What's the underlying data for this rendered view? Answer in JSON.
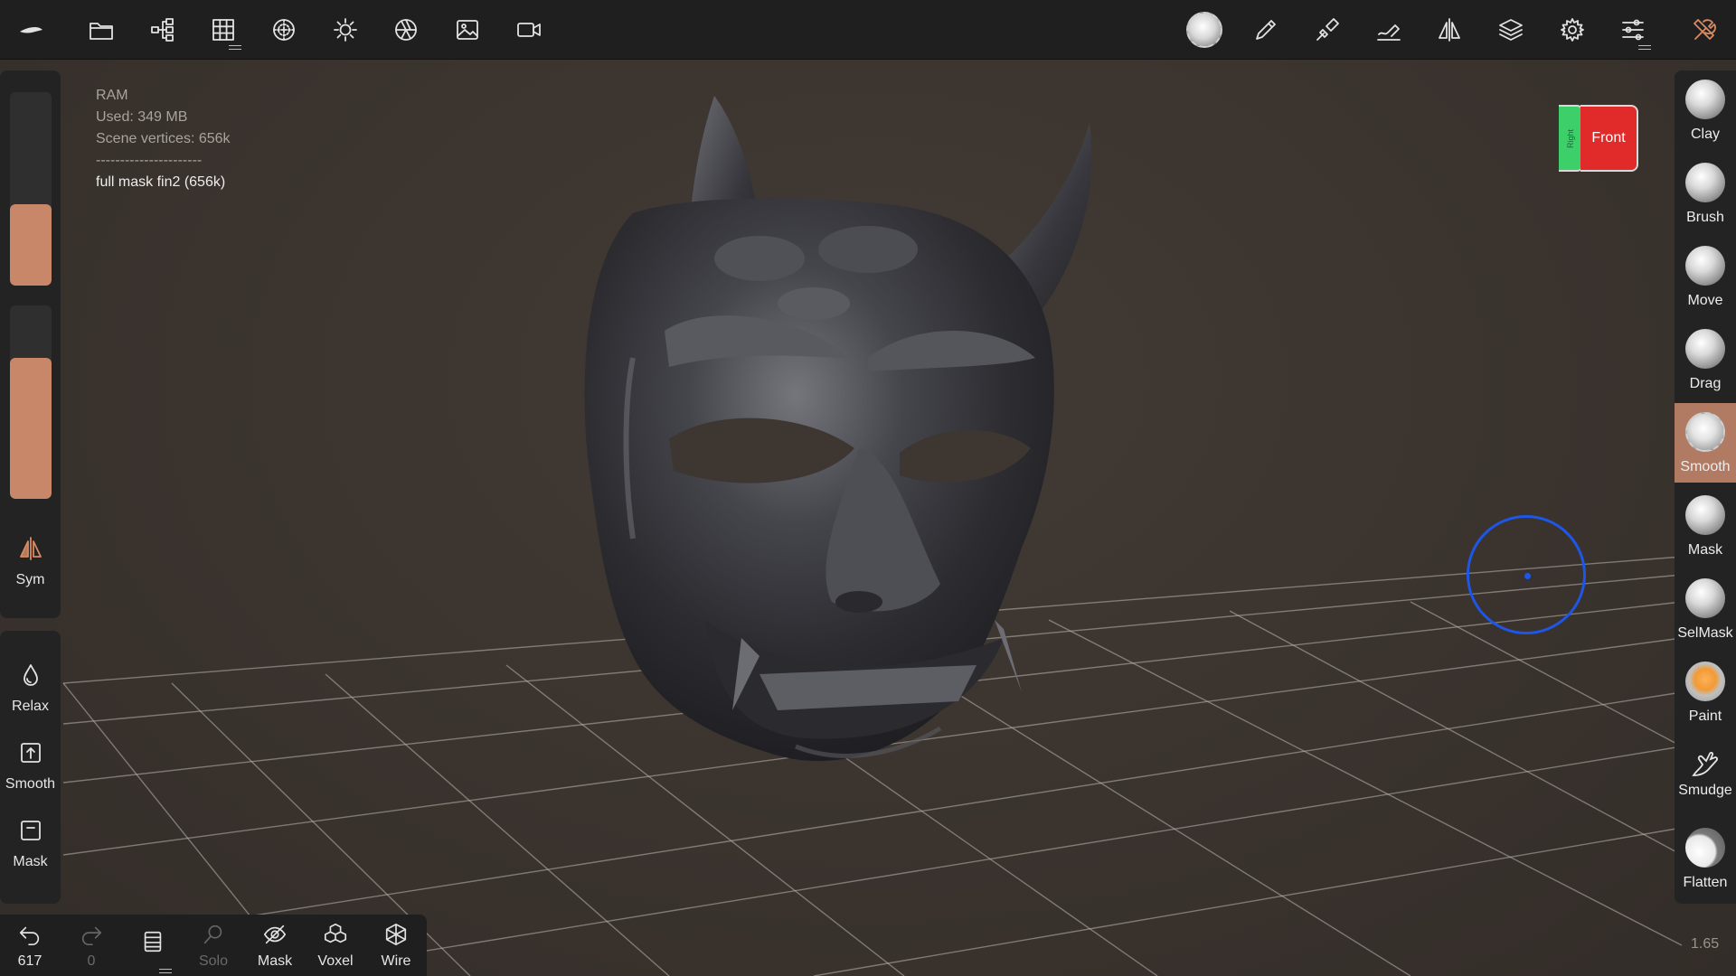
{
  "toolbar": {
    "left_icons": [
      {
        "name": "app-logo-icon"
      },
      {
        "name": "folder-icon"
      },
      {
        "name": "scene-tree-icon"
      },
      {
        "name": "topology-grid-icon"
      },
      {
        "name": "material-sphere-icon"
      },
      {
        "name": "lighting-sun-icon"
      },
      {
        "name": "camera-aperture-icon"
      },
      {
        "name": "background-image-icon"
      },
      {
        "name": "video-camera-icon"
      }
    ],
    "right_icons": [
      {
        "name": "brush-alpha-icon"
      },
      {
        "name": "stroke-pen-icon"
      },
      {
        "name": "painting-brush-icon"
      },
      {
        "name": "pen-settings-icon"
      },
      {
        "name": "symmetry-icon"
      },
      {
        "name": "layers-icon"
      },
      {
        "name": "settings-gear-icon"
      },
      {
        "name": "sliders-icon"
      },
      {
        "name": "tools-wrench-icon"
      }
    ]
  },
  "info": {
    "ram_label": "RAM",
    "used": "Used: 349 MB",
    "vertices": "Scene vertices: 656k",
    "separator": "----------------------",
    "mesh_name": "full mask fin2 (656k)"
  },
  "left_panel": {
    "radius_slider_level": 0.42,
    "intensity_slider_level": 0.73,
    "sym_label": "Sym",
    "buttons": [
      {
        "label": "Relax"
      },
      {
        "label": "Smooth"
      },
      {
        "label": "Mask"
      }
    ]
  },
  "bottom_toolbar": {
    "undo_count": "617",
    "redo_count": "0",
    "solo_label": "Solo",
    "mask_label": "Mask",
    "voxel_label": "Voxel",
    "wire_label": "Wire"
  },
  "tools": [
    {
      "label": "Clay",
      "active": false
    },
    {
      "label": "Brush",
      "active": false
    },
    {
      "label": "Move",
      "active": false
    },
    {
      "label": "Drag",
      "active": false
    },
    {
      "label": "Smooth",
      "active": true
    },
    {
      "label": "Mask",
      "active": false
    },
    {
      "label": "SelMask",
      "active": false
    },
    {
      "label": "Paint",
      "active": false
    },
    {
      "label": "Smudge",
      "active": false
    },
    {
      "label": "Flatten",
      "active": false
    }
  ],
  "viewcube": {
    "side_label": "Right",
    "front_label": "Front"
  },
  "zoom_level": "1.65",
  "colors": {
    "accent": "#b07a63",
    "slider_fill": "#c9876a",
    "brush_cursor": "#1e57e8",
    "viewcube_front": "#e12a2a",
    "viewcube_side": "#3ccf6a"
  }
}
